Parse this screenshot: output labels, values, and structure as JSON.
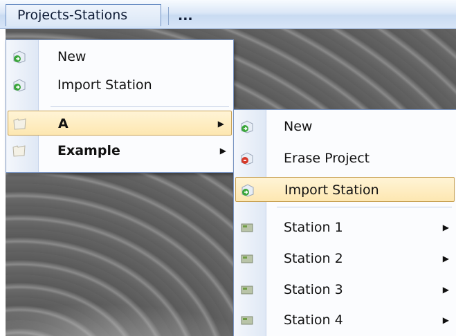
{
  "menubar": {
    "menu_label": "Projects-Stations",
    "overflow": "..."
  },
  "main_menu": {
    "items": [
      {
        "label": "New",
        "icon": "new-green-arrow-icon"
      },
      {
        "label": "Import Station",
        "icon": "import-green-arrow-icon"
      },
      {
        "label": "A",
        "icon": "folder-icon",
        "submenu": true,
        "selected": true
      },
      {
        "label": "Example",
        "icon": "folder-icon",
        "submenu": true
      }
    ]
  },
  "submenu": {
    "items": [
      {
        "label": "New",
        "icon": "new-green-arrow-icon"
      },
      {
        "label": "Erase Project",
        "icon": "erase-red-icon"
      },
      {
        "label": "Import Station",
        "icon": "import-green-arrow-icon",
        "selected": true
      },
      {
        "label": "Station 1",
        "icon": "station-icon",
        "submenu": true
      },
      {
        "label": "Station 2",
        "icon": "station-icon",
        "submenu": true
      },
      {
        "label": "Station 3",
        "icon": "station-icon",
        "submenu": true
      },
      {
        "label": "Station 4",
        "icon": "station-icon",
        "submenu": true
      }
    ]
  },
  "colors": {
    "selection_fill": "#fde7b1",
    "selection_border": "#c7a052",
    "menu_border": "#7a95c2",
    "green_icon": "#3aa63a",
    "red_icon": "#d63a2a"
  }
}
